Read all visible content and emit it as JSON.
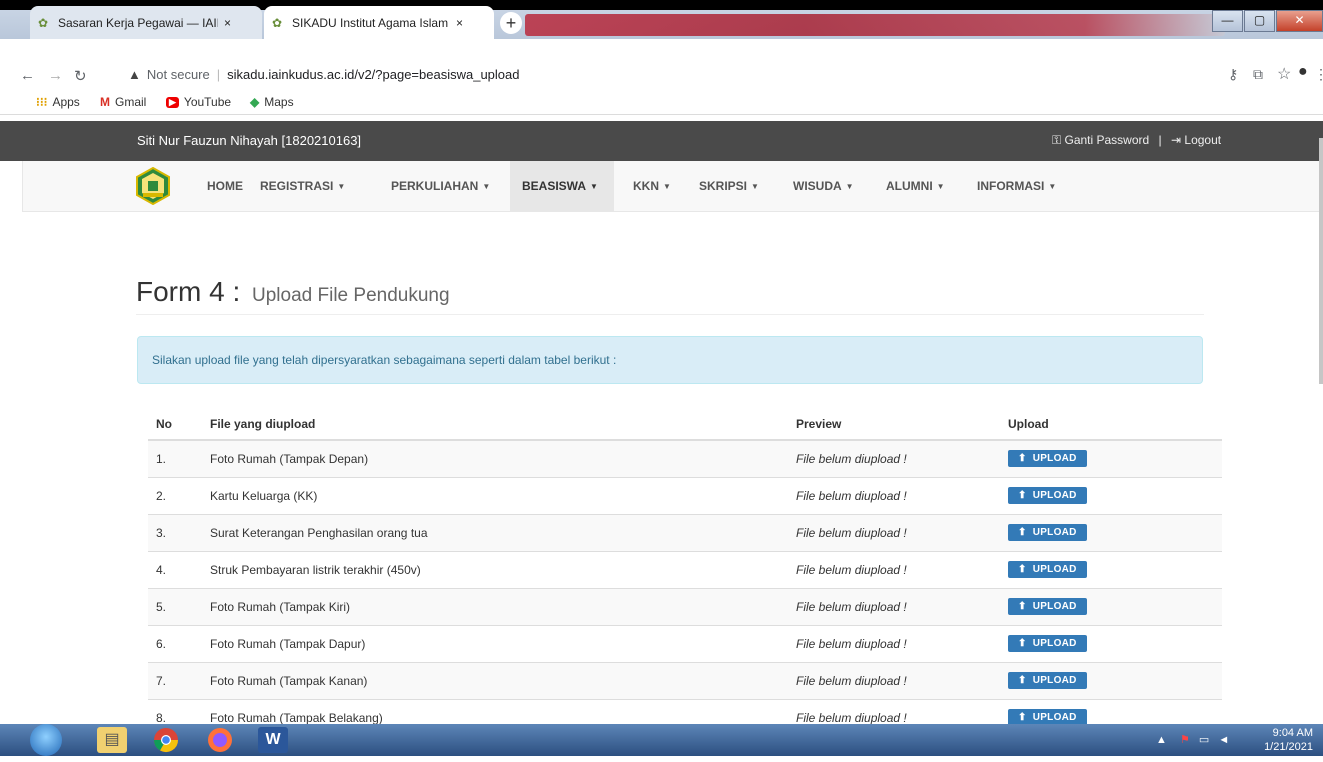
{
  "browser": {
    "tabs": [
      {
        "title": "Sasaran Kerja Pegawai — IAIN Ku",
        "close": "×"
      },
      {
        "title": "SIKADU Institut Agama Islam Ne",
        "close": "×"
      }
    ],
    "new_tab": "+",
    "window_buttons": {
      "minimize": "—",
      "maximize": "▢",
      "close": "✕"
    },
    "security": "Not secure",
    "url": "sikadu.iainkudus.ac.id/v2/?page=beasiswa_upload",
    "bookmarks": [
      "Apps",
      "Gmail",
      "YouTube",
      "Maps"
    ]
  },
  "site": {
    "user": "Siti Nur Fauzun Nihayah [1820210163]",
    "links": {
      "password": "Ganti Password",
      "separator": "|",
      "logout": "Logout"
    },
    "menu": [
      {
        "label": "HOME",
        "dropdown": false
      },
      {
        "label": "REGISTRASI",
        "dropdown": true
      },
      {
        "label": "PERKULIAHAN",
        "dropdown": true
      },
      {
        "label": "BEASISWA",
        "dropdown": true,
        "active": true
      },
      {
        "label": "KKN",
        "dropdown": true
      },
      {
        "label": "SKRIPSI",
        "dropdown": true
      },
      {
        "label": "WISUDA",
        "dropdown": true
      },
      {
        "label": "ALUMNI",
        "dropdown": true
      },
      {
        "label": "INFORMASI",
        "dropdown": true
      }
    ]
  },
  "page": {
    "title": "Form 4 :",
    "subtitle": "Upload File Pendukung",
    "notice": "Silakan upload file yang telah dipersyaratkan sebagaimana seperti dalam tabel berikut :",
    "columns": [
      "No",
      "File yang diupload",
      "Preview",
      "Upload"
    ],
    "rows": [
      {
        "no": "1.",
        "file": "Foto Rumah (Tampak Depan)",
        "preview": "File belum diupload !",
        "button": "UPLOAD"
      },
      {
        "no": "2.",
        "file": "Kartu Keluarga (KK)",
        "preview": "File belum diupload !",
        "button": "UPLOAD"
      },
      {
        "no": "3.",
        "file": "Surat Keterangan Penghasilan orang tua",
        "preview": "File belum diupload !",
        "button": "UPLOAD"
      },
      {
        "no": "4.",
        "file": "Struk Pembayaran listrik terakhir (450v)",
        "preview": "File belum diupload !",
        "button": "UPLOAD"
      },
      {
        "no": "5.",
        "file": "Foto Rumah (Tampak Kiri)",
        "preview": "File belum diupload !",
        "button": "UPLOAD"
      },
      {
        "no": "6.",
        "file": "Foto Rumah (Tampak Dapur)",
        "preview": "File belum diupload !",
        "button": "UPLOAD"
      },
      {
        "no": "7.",
        "file": "Foto Rumah (Tampak Kanan)",
        "preview": "File belum diupload !",
        "button": "UPLOAD"
      },
      {
        "no": "8.",
        "file": "Foto Rumah (Tampak Belakang)",
        "preview": "File belum diupload !",
        "button": "UPLOAD"
      }
    ]
  },
  "taskbar": {
    "time": "9:04 AM",
    "date": "1/21/2021"
  }
}
